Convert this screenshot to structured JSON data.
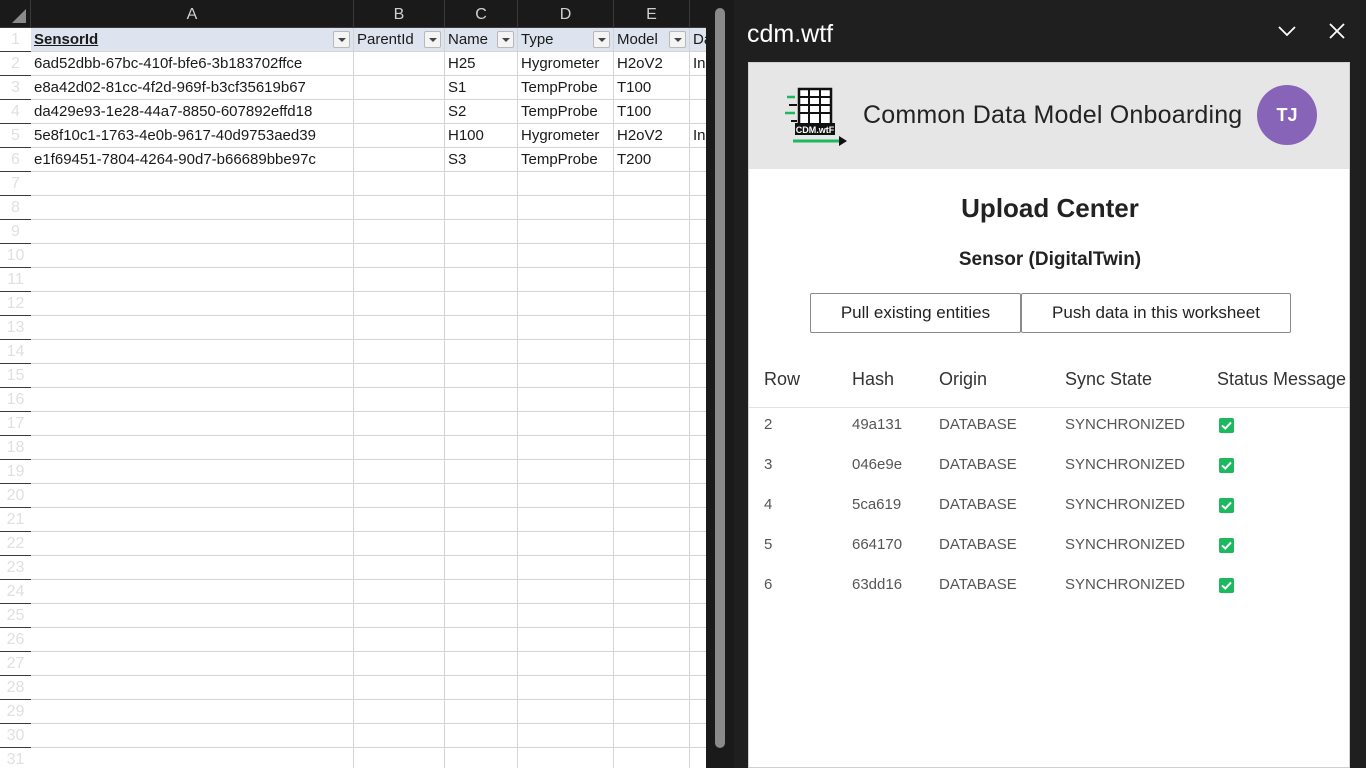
{
  "spreadsheet": {
    "columns": [
      "A",
      "B",
      "C",
      "D",
      "E"
    ],
    "row_numbers": [
      "1",
      "2",
      "3",
      "4",
      "5",
      "6",
      "7",
      "8",
      "9",
      "10",
      "11",
      "12",
      "13",
      "14",
      "15",
      "16",
      "17",
      "18",
      "19",
      "20",
      "21",
      "22",
      "23",
      "24",
      "25",
      "26",
      "27",
      "28",
      "29",
      "30",
      "31"
    ],
    "headers": [
      "SensorId",
      "ParentId",
      "Name",
      "Type",
      "Model",
      "Da"
    ],
    "rows": [
      [
        "6ad52dbb-67bc-410f-bfe6-3b183702ffce",
        "",
        "H25",
        "Hygrometer",
        "H2oV2",
        "In"
      ],
      [
        "e8a42d02-81cc-4f2d-969f-b3cf35619b67",
        "",
        "S1",
        "TempProbe",
        "T100",
        ""
      ],
      [
        "da429e93-1e28-44a7-8850-607892effd18",
        "",
        "S2",
        "TempProbe",
        "T100",
        ""
      ],
      [
        "5e8f10c1-1763-4e0b-9617-40d9753aed39",
        "",
        "H100",
        "Hygrometer",
        "H2oV2",
        "In"
      ],
      [
        "e1f69451-7804-4264-90d7-b66689bbe97c",
        "",
        "S3",
        "TempProbe",
        "T200",
        ""
      ]
    ]
  },
  "pane": {
    "title": "cdm.wtf",
    "collapse_icon": "chevron-down-icon",
    "close_icon": "close-icon"
  },
  "addin": {
    "logo_text": "CDM.wtF",
    "app_title": "Common Data Model Onboarding",
    "avatar_initials": "TJ",
    "avatar_color": "#8764b8",
    "upload_title": "Upload Center",
    "entity_title": "Sensor (DigitalTwin)",
    "pull_button": "Pull existing entities",
    "push_button": "Push data in this worksheet",
    "table": {
      "headers": [
        "Row",
        "Hash",
        "Origin",
        "Sync State",
        "Status Message"
      ],
      "rows": [
        {
          "row": "2",
          "hash": "49a131",
          "origin": "DATABASE",
          "state": "SYNCHRONIZED",
          "status": "check-icon"
        },
        {
          "row": "3",
          "hash": "046e9e",
          "origin": "DATABASE",
          "state": "SYNCHRONIZED",
          "status": "check-icon"
        },
        {
          "row": "4",
          "hash": "5ca619",
          "origin": "DATABASE",
          "state": "SYNCHRONIZED",
          "status": "check-icon"
        },
        {
          "row": "5",
          "hash": "664170",
          "origin": "DATABASE",
          "state": "SYNCHRONIZED",
          "status": "check-icon"
        },
        {
          "row": "6",
          "hash": "63dd16",
          "origin": "DATABASE",
          "state": "SYNCHRONIZED",
          "status": "check-icon"
        }
      ]
    },
    "status_color": "#1eb85f"
  }
}
